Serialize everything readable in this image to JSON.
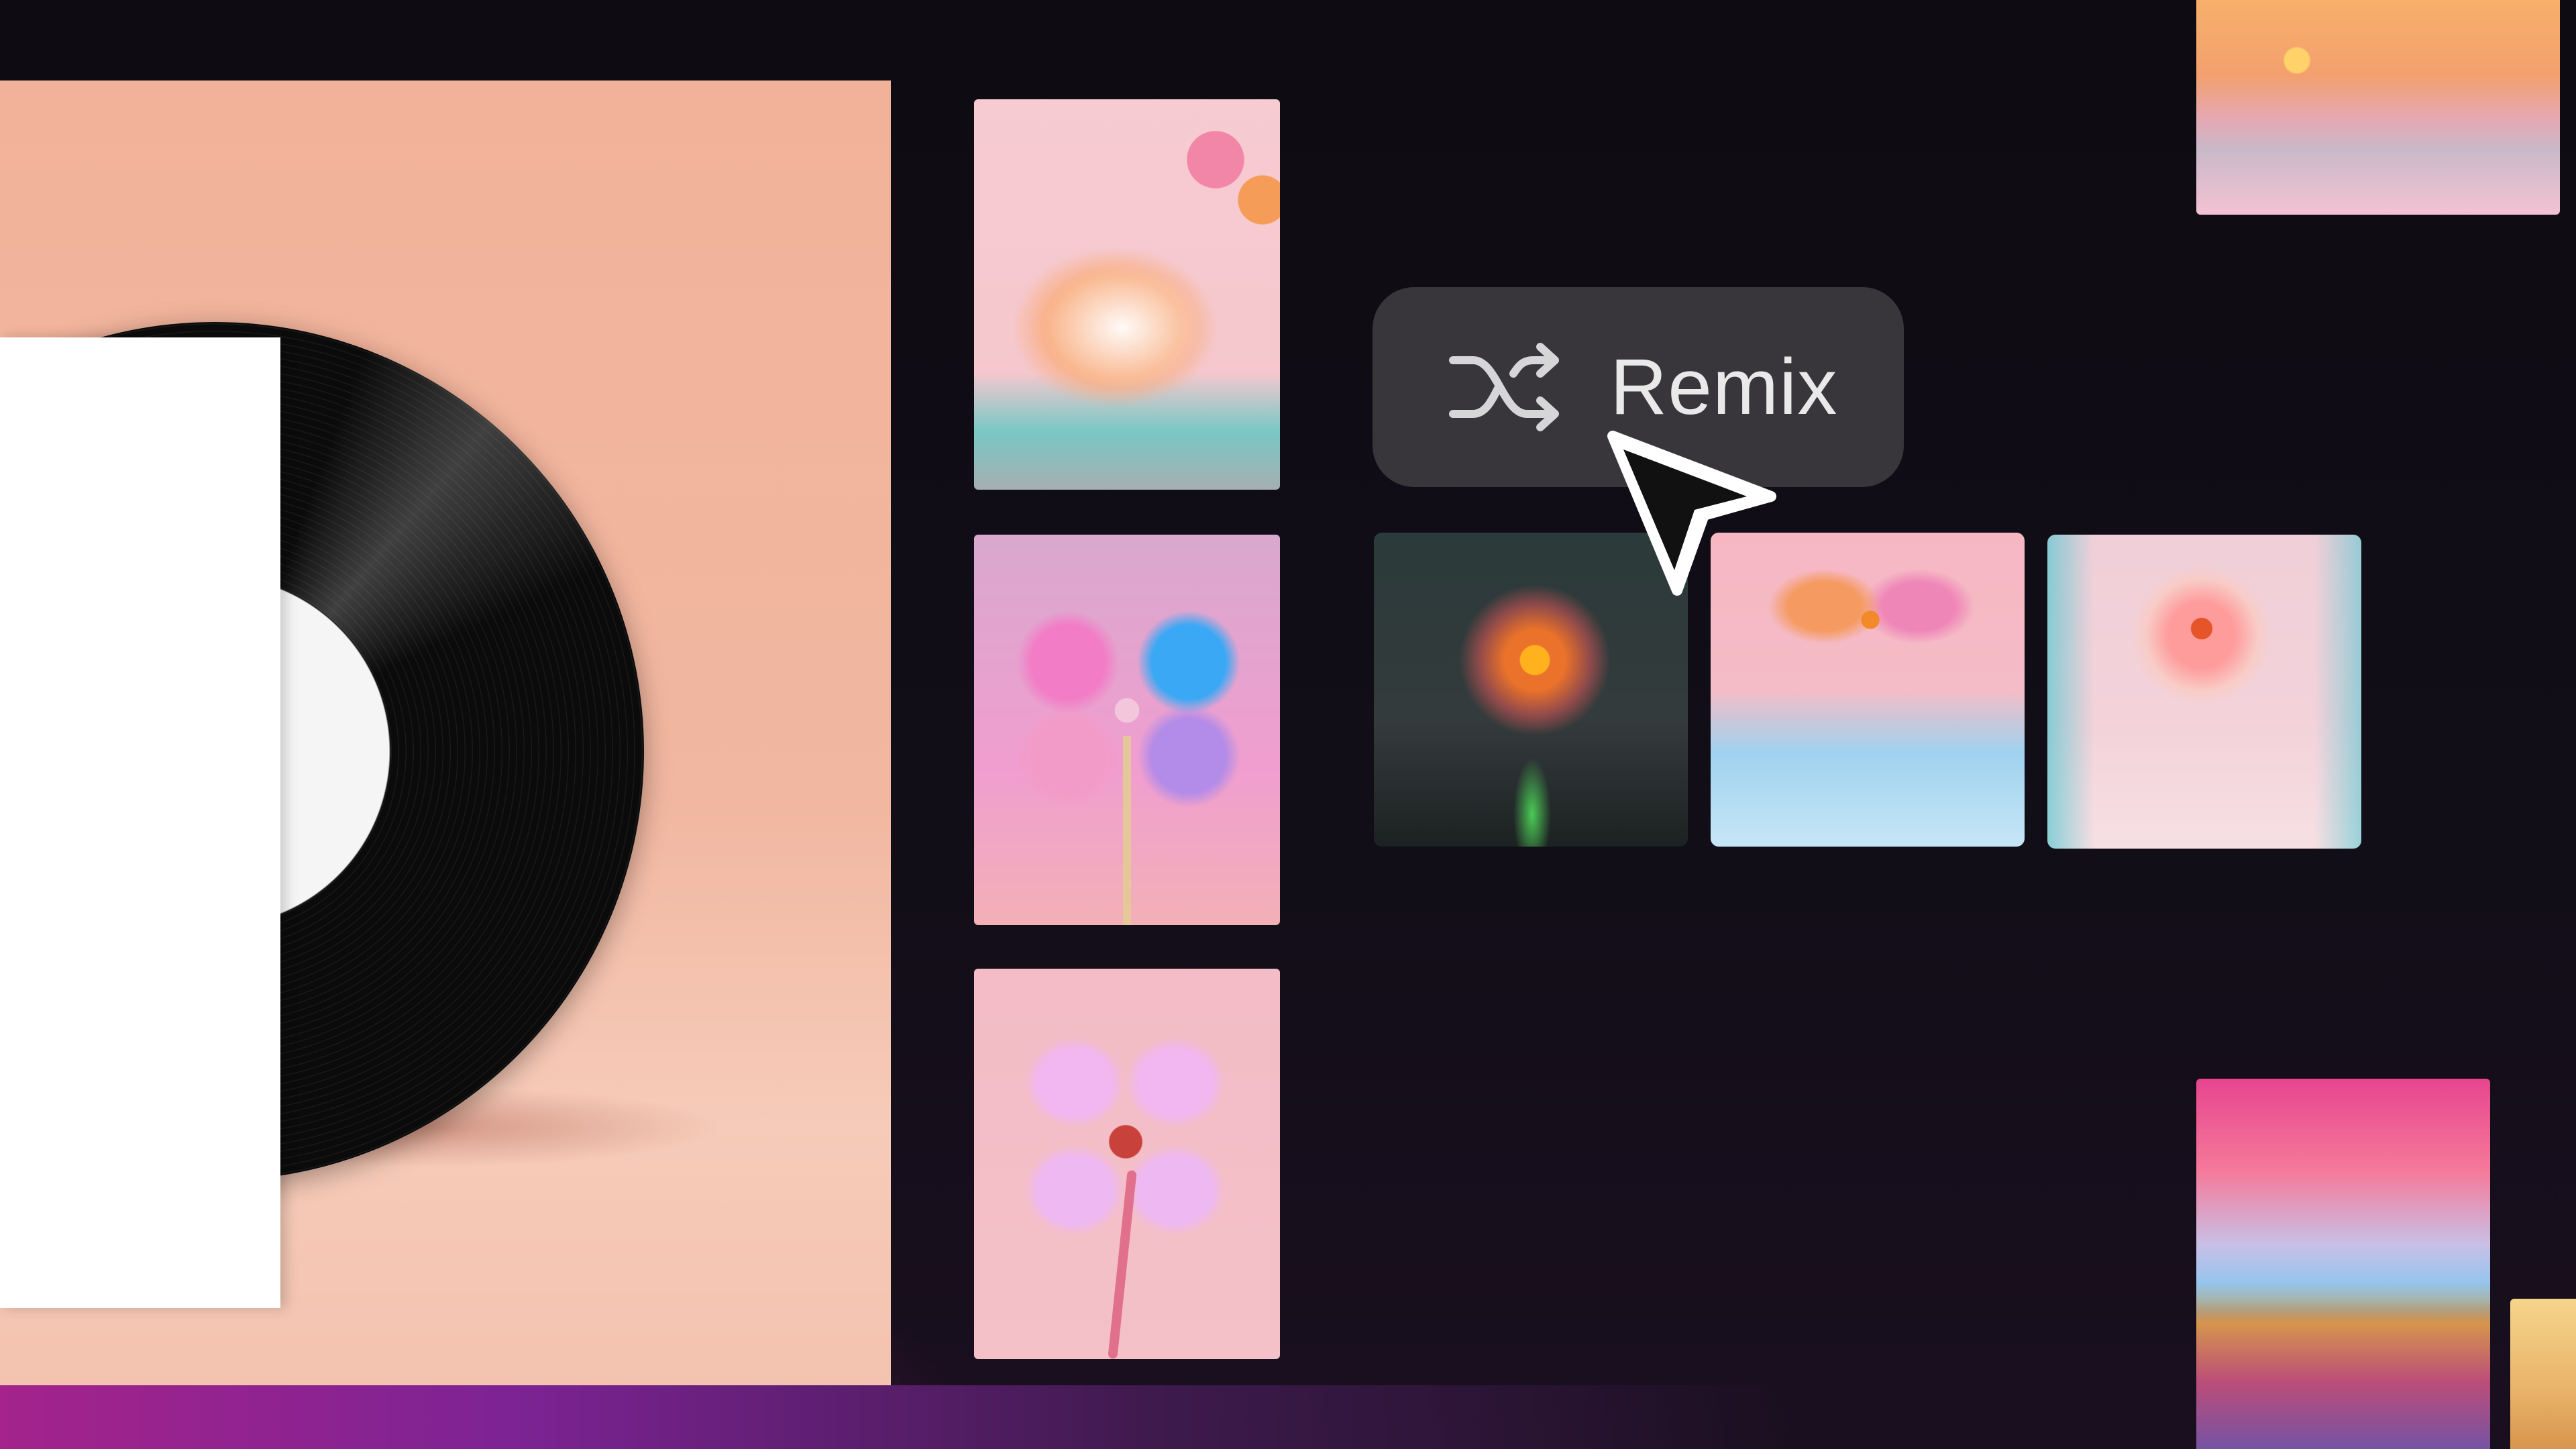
{
  "remix_button": {
    "label": "Remix",
    "icon": "shuffle-icon"
  },
  "cursor": {
    "icon": "arrow-pointer-icon"
  },
  "colors": {
    "button_bg": "#3a383c",
    "button_text": "#e9e9ea",
    "page_bg": "#110d18",
    "accent_magenta": "#a4238c"
  }
}
